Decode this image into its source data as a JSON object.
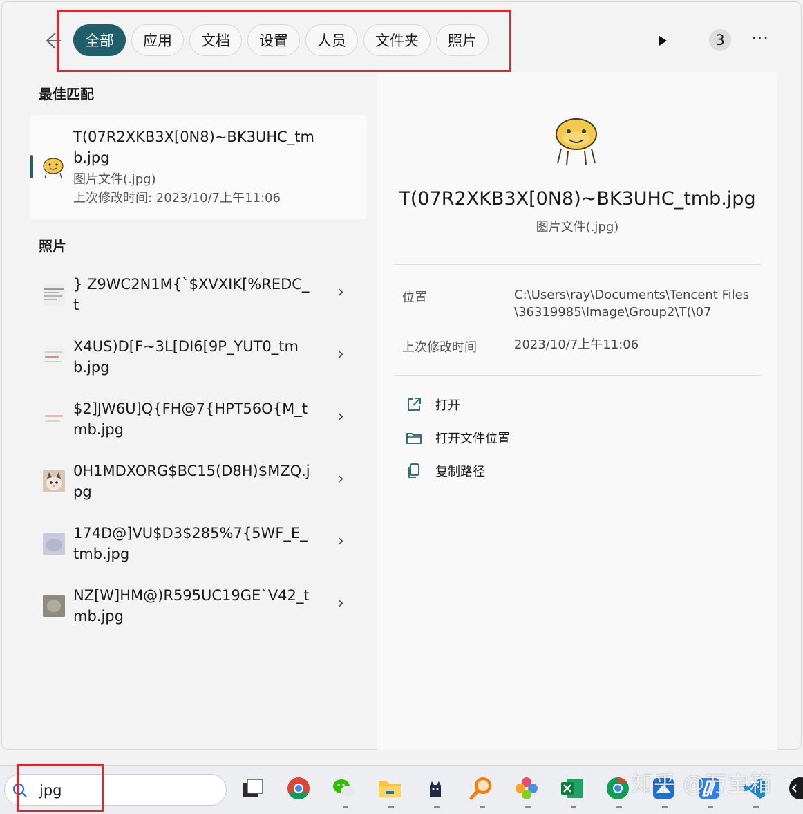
{
  "header": {
    "tabs": [
      {
        "label": "全部",
        "active": true
      },
      {
        "label": "应用",
        "active": false
      },
      {
        "label": "文档",
        "active": false
      },
      {
        "label": "设置",
        "active": false
      },
      {
        "label": "人员",
        "active": false
      },
      {
        "label": "文件夹",
        "active": false
      },
      {
        "label": "照片",
        "active": false
      }
    ],
    "count": "3",
    "more": "···"
  },
  "best_match": {
    "section": "最佳匹配",
    "title": "T(07R2XKB3X[0N8)~BK3UHC_tmb.jpg",
    "type": "图片文件(.jpg)",
    "modified": "上次修改时间: 2023/10/7上午11:06"
  },
  "photos": {
    "section": "照片",
    "items": [
      {
        "name": "} Z9WC2N1M{`$XVXIK[%REDC_t"
      },
      {
        "name": "X4US)D[F~3L[DI6[9P_YUT0_tmb.jpg"
      },
      {
        "name": "$2]JW6U]Q{FH@7{HPT56O{M_tmb.jpg"
      },
      {
        "name": "0H1MDXORG$BC15(D8H)$MZQ.jpg"
      },
      {
        "name": "174D@]VU$D3$285%7{5WF_E_tmb.jpg"
      },
      {
        "name": "NZ[W]HM@)R595UC19GE`V42_tmb.jpg"
      }
    ]
  },
  "preview": {
    "title": "T(07R2XKB3X[0N8)~BK3UHC_tmb.jpg",
    "type": "图片文件(.jpg)",
    "location_label": "位置",
    "location_value": "C:\\Users\\ray\\Documents\\Tencent Files\\36319985\\Image\\Group2\\T(\\07",
    "modified_label": "上次修改时间",
    "modified_value": "2023/10/7上午11:06",
    "actions": [
      {
        "label": "打开"
      },
      {
        "label": "打开文件位置"
      },
      {
        "label": "复制路径"
      }
    ]
  },
  "taskbar": {
    "search_value": "jpg"
  },
  "watermark": "知乎 @万宝箱",
  "colors": {
    "accent": "#1f5f6b",
    "annotation": "#e3262e"
  }
}
